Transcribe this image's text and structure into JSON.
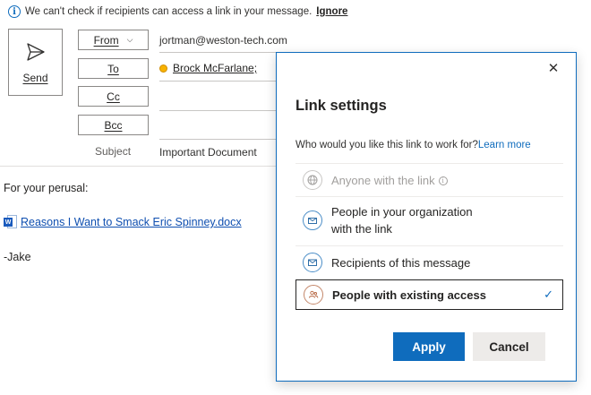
{
  "infobar": {
    "message": "We can't check if recipients can access a link in your message.",
    "ignore_label": "Ignore"
  },
  "compose": {
    "send_label": "Send",
    "from_label": "From",
    "from_value": "jortman@weston-tech.com",
    "to_label": "To",
    "to_recipient": "Brock McFarlane;",
    "cc_label": "Cc",
    "bcc_label": "Bcc",
    "subject_label": "Subject",
    "subject_value": "Important Document"
  },
  "body": {
    "line1": "For your perusal:",
    "attachment_name": "Reasons I Want to Smack Eric Spinney.docx",
    "signature": "-Jake"
  },
  "link_settings": {
    "title": "Link settings",
    "question": "Who would you like this link to work for?",
    "learn_more": "Learn more",
    "options": [
      {
        "label": "Anyone with the link",
        "icon": "globe-icon",
        "state": "disabled"
      },
      {
        "label_line1": "People in your organization",
        "label_line2": "with the link",
        "icon": "building-icon",
        "state": "enabled"
      },
      {
        "label": "Recipients of this message",
        "icon": "envelope-icon",
        "state": "enabled"
      },
      {
        "label": "People with existing access",
        "icon": "people-icon",
        "state": "selected"
      }
    ],
    "apply_label": "Apply",
    "cancel_label": "Cancel"
  },
  "colors": {
    "accent": "#0f6cbd",
    "link": "#0f4fb0",
    "disabled_text": "#a19f9d",
    "presence": "#f8b200"
  }
}
